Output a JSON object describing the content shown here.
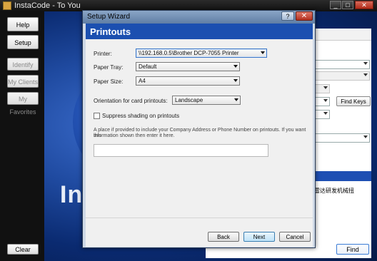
{
  "main_window": {
    "title": "InstaCode - To You",
    "controls": {
      "minimize": "_",
      "maximize": "□",
      "close": "✕"
    }
  },
  "sidebar": {
    "help": "Help",
    "setup": "Setup",
    "identify_key": "Identify Key",
    "my_clients": "My Clients",
    "my_favorites": "My Favorites",
    "clear": "Clear"
  },
  "background": {
    "logo_fragment": "In",
    "chinese_text": "雷达研发机械扭",
    "find_keys": "Find Keys",
    "find": "Find"
  },
  "dialog": {
    "title": "Setup Wizard",
    "help_glyph": "?",
    "close_glyph": "✕",
    "header": "Printouts",
    "printer_label": "Printer:",
    "printer_value": "\\\\192.168.0.5\\Brother DCP-7055 Printer",
    "tray_label": "Paper Tray:",
    "tray_value": "Default",
    "size_label": "Paper Size:",
    "size_value": "A4",
    "orientation_label": "Orientation for card printouts:",
    "orientation_value": "Landscape",
    "suppress_label": "Suppress shading on printouts",
    "suppress_checked": false,
    "info_line1": "A place if provided to include your Company Address or Phone Number on printouts.  If you want this",
    "info_line2": "information shown then enter it here.",
    "info_value": "",
    "back": "Back",
    "next": "Next",
    "cancel": "Cancel"
  },
  "colors": {
    "header_blue": "#1b4fb0",
    "art_blue": "#1f4aa0"
  }
}
